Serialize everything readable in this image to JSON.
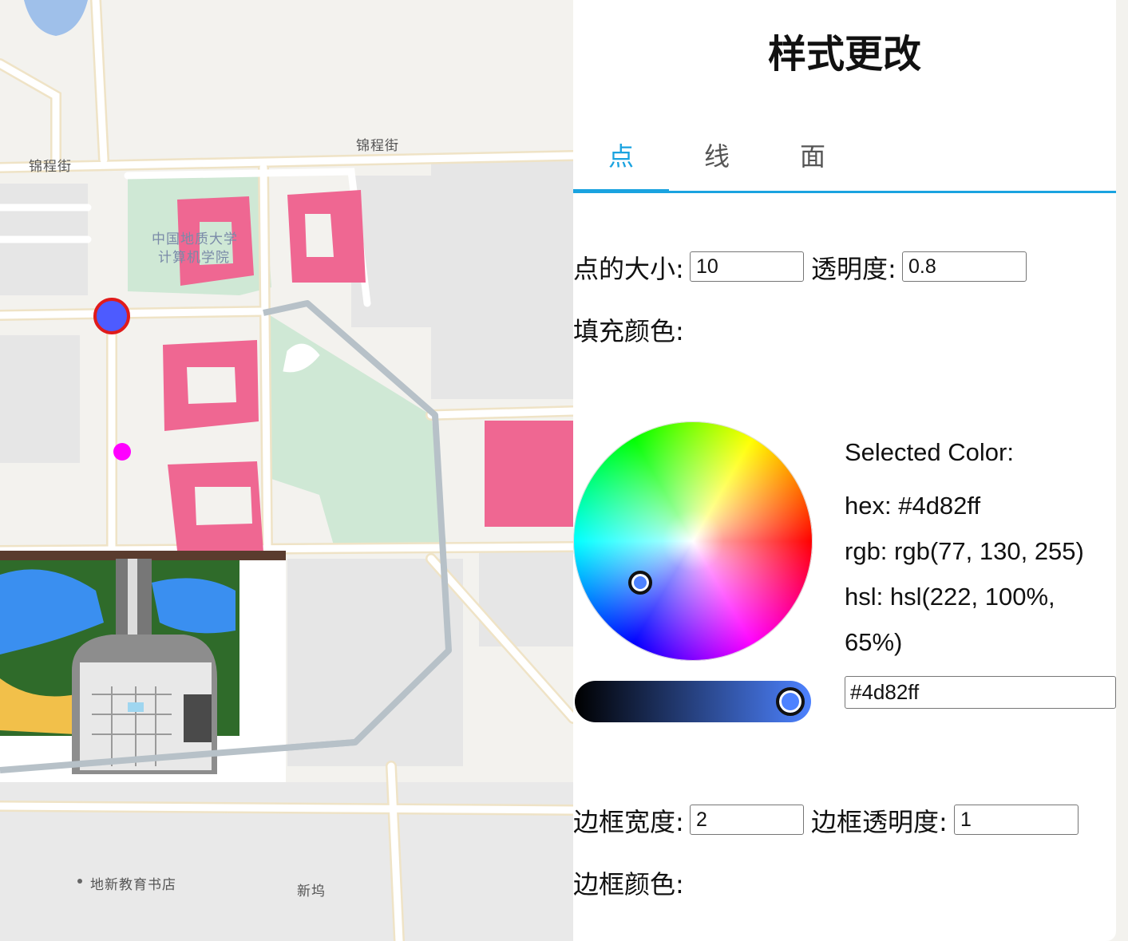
{
  "map": {
    "labels": {
      "street_left": "锦程街",
      "street_right": "锦程街",
      "campus_line1": "中国地质大学",
      "campus_line2": "计算机学院",
      "bookstore": "地新教育书店",
      "xinwu": "新坞"
    },
    "colors": {
      "building": "#ef6792",
      "route": "#b7c1c8",
      "green": "#cfe8d5",
      "water": "#9fc0ea",
      "road": "#ffffff",
      "road_edge": "#efe3c6"
    },
    "markers": {
      "selected_point": {
        "fill": "#4d5bff",
        "stroke": "#e01b1b"
      },
      "magenta_point": {
        "fill": "#ff00ff"
      }
    }
  },
  "panel": {
    "title": "样式更改",
    "tabs": [
      {
        "label": "点",
        "active": true
      },
      {
        "label": "线",
        "active": false
      },
      {
        "label": "面",
        "active": false
      }
    ],
    "point_size_label": "点的大小:",
    "point_size_value": "10",
    "opacity_label": "透明度:",
    "opacity_value": "0.8",
    "fill_color_label": "填充颜色:",
    "picker": {
      "selected_color_heading": "Selected Color:",
      "hex_text": "hex: #4d82ff",
      "rgb_text": "rgb: rgb(77, 130, 255)",
      "hsl_text_line1": "hsl: hsl(222, 100%,",
      "hsl_text_line2": "65%)",
      "hex_input_value": "#4d82ff",
      "current_color": "#4d82ff"
    },
    "border_width_label": "边框宽度:",
    "border_width_value": "2",
    "border_opacity_label": "边框透明度:",
    "border_opacity_value": "1",
    "border_color_label": "边框颜色:",
    "accent_color": "#1aa3e0"
  }
}
